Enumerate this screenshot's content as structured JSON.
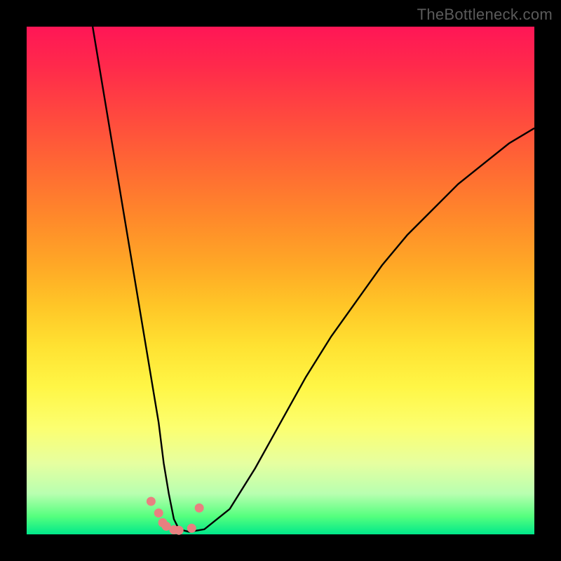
{
  "watermark": "TheBottleneck.com",
  "colors": {
    "background": "#000000",
    "gradient_top": "#ff1656",
    "gradient_bottom": "#00e88a",
    "curve_stroke": "#000000",
    "marker_fill": "#e98080"
  },
  "chart_data": {
    "type": "line",
    "title": "",
    "xlabel": "",
    "ylabel": "",
    "xlim": [
      0,
      100
    ],
    "ylim": [
      0,
      100
    ],
    "annotations": [
      "TheBottleneck.com"
    ],
    "series": [
      {
        "name": "bottleneck-curve",
        "x": [
          13,
          15,
          17,
          19,
          21,
          23,
          25,
          26,
          27,
          28,
          29,
          30,
          32,
          35,
          40,
          45,
          50,
          55,
          60,
          65,
          70,
          75,
          80,
          85,
          90,
          95,
          100
        ],
        "values": [
          100,
          88,
          76,
          64,
          52,
          40,
          28,
          22,
          14,
          8,
          3,
          1,
          0.5,
          1,
          5,
          13,
          22,
          31,
          39,
          46,
          53,
          59,
          64,
          69,
          73,
          77,
          80
        ]
      }
    ],
    "markers": {
      "name": "highlight-points",
      "x": [
        24.5,
        26,
        26.8,
        27.5,
        29,
        30,
        32.5,
        34
      ],
      "values": [
        6.5,
        4.2,
        2.3,
        1.6,
        0.9,
        0.8,
        1.2,
        5.2
      ]
    }
  }
}
